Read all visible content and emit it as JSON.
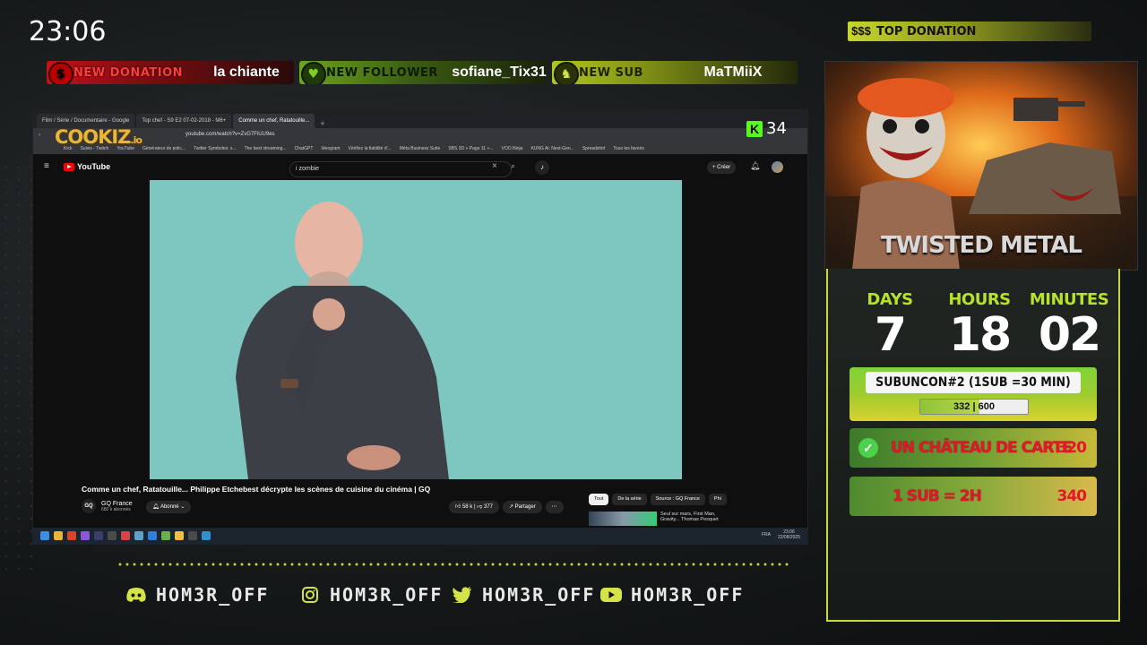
{
  "overlay": {
    "clock": "23:06",
    "alerts": {
      "donation": {
        "label": "NEW DONATION",
        "value": "la chiante",
        "icon": "$"
      },
      "follower": {
        "label": "NEW FOLLOWER",
        "value": "sofiane_Tix31",
        "icon": "♥"
      },
      "sub": {
        "label": "NEW SUB",
        "value": "MaTMiiX",
        "icon": "♞"
      }
    },
    "top_donation": {
      "label": "TOP DONATION",
      "icon": "$$$"
    },
    "poster_title": "TWISTED METAL",
    "countdown": {
      "days_label": "DAYS",
      "days": "7",
      "hours_label": "HOURS",
      "hours": "18",
      "minutes_label": "MINUTES",
      "minutes": "02"
    },
    "subgoal": {
      "title": "SUBUNCON#2 (1SUB =30 MIN)",
      "current": 332,
      "target": 600,
      "progress_text": "332 | 600"
    },
    "goals": [
      {
        "text": "UN CHÂTEAU DE CARTE",
        "value": "320",
        "done": true
      },
      {
        "text": "1 SUB = 2H",
        "value": "340",
        "done": false
      }
    ],
    "socials": [
      {
        "icon": "discord-icon",
        "handle": "HOM3R_OFF"
      },
      {
        "icon": "instagram-icon",
        "handle": "HOM3R_OFF"
      },
      {
        "icon": "twitter-icon",
        "handle": "HOM3R_OFF"
      },
      {
        "icon": "youtube-icon",
        "handle": "HOM3R_OFF"
      }
    ],
    "watermark": "COOKIZ",
    "watermark_suffix": ".io",
    "kick_viewers": "34",
    "accent": "#c9d73a"
  },
  "browser": {
    "tabs": [
      {
        "label": "Film / Série / Documentaire - Google"
      },
      {
        "label": "Top chef - S9 E2 07-02-2018 - M6+"
      },
      {
        "label": "Comme un chef, Ratatouille..."
      }
    ],
    "url": "youtube.com/watch?v=ZvG7FiUU9es",
    "bookmarks": [
      "Kick",
      "Suivis - Twitch",
      "YouTube",
      "Générateur de polic...",
      "Twitter Symboles: s...",
      "The best streaming...",
      "ChatGPT",
      "Ideogram",
      "Vérifiez la fiabilité d'...",
      "Méta Business Suite",
      "SBS 3D + Page 11 +...",
      "VOO.Ninja",
      "KUNG Ai: Next-Gen...",
      "Spreadshirt",
      "Tous les favoris"
    ]
  },
  "youtube": {
    "logo": "YouTube",
    "search_value": "i zombie",
    "create": "Créer",
    "video_title": "Comme un chef, Ratatouille... Philippe Etchebest décrypte les scènes de cuisine du cinéma | GQ",
    "channel": "GQ France",
    "channel_logo": "GQ",
    "subscribers": "680 k abonnés",
    "subscribed": "Abonné",
    "likes": "58 k",
    "dislikes": "377",
    "share": "Partager",
    "chips": [
      "Tout",
      "De la série",
      "Source : GQ France",
      "Phi"
    ],
    "rec_text": "Seul sur mars, First Man, Gravity... Thomas Pesquet"
  },
  "taskbar": {
    "lang": "FRA",
    "time": "23:06",
    "date": "22/08/2025"
  }
}
